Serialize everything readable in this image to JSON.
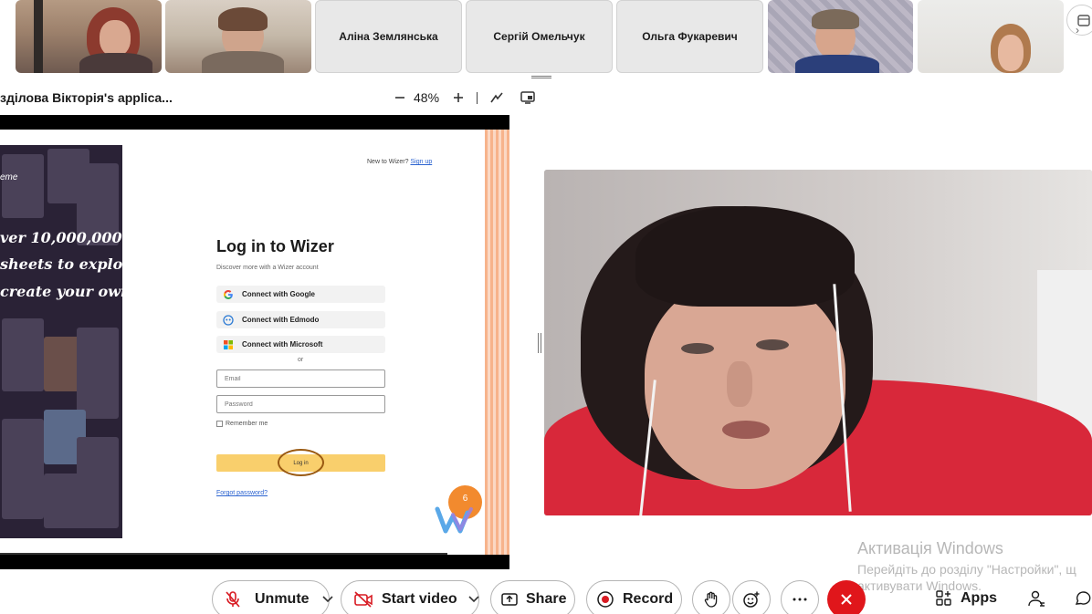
{
  "participants": [
    {
      "type": "video"
    },
    {
      "type": "video"
    },
    {
      "type": "name",
      "name": "Аліна Землянська"
    },
    {
      "type": "name",
      "name": "Сергій Омельчук"
    },
    {
      "type": "name",
      "name": "Ольга Фукаревич"
    },
    {
      "type": "video"
    },
    {
      "type": "video"
    }
  ],
  "share": {
    "title": "здiлова Вiкторiя's applica...",
    "zoom": "48%"
  },
  "wizer": {
    "hero_lines": [
      "ver 10,000,000",
      "sheets to explore",
      "create your own"
    ],
    "logo_fragment": "eme",
    "new_to_wizer": "New to Wizer?",
    "sign_up": "Sign up",
    "title": "Log in to Wizer",
    "subtitle": "Discover more with a Wizer account",
    "connect_google": "Connect with Google",
    "connect_edmodo": "Connect with Edmodo",
    "connect_microsoft": "Connect with Microsoft",
    "or": "or",
    "email_placeholder": "Email",
    "password_placeholder": "Password",
    "remember_me": "Remember me",
    "login": "Log in",
    "forgot_password": "Forgot password?",
    "badge": "6"
  },
  "windows_activation": {
    "title": "Активація Windows",
    "line1": "Перейдіть до розділу \"Настройки\", щ",
    "line2": "активувати Windows."
  },
  "controls": {
    "unmute": "Unmute",
    "start_video": "Start video",
    "share": "Share",
    "record": "Record",
    "apps": "Apps"
  },
  "colors": {
    "leave_red": "#e0161b",
    "wizer_yellow": "#f9cf6c",
    "badge_orange": "#f28a2e"
  }
}
